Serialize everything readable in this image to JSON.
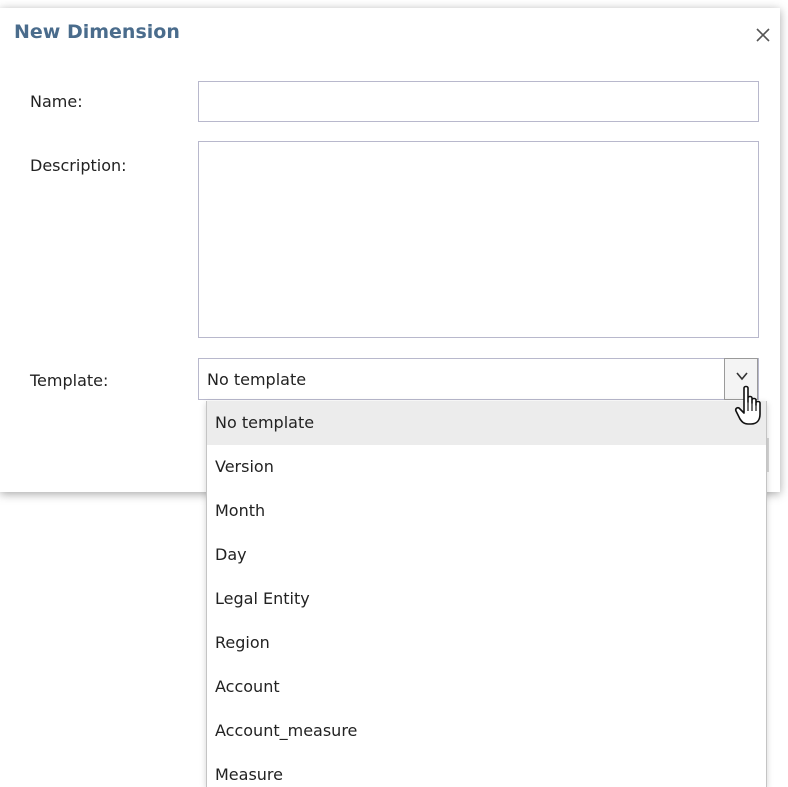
{
  "dialog": {
    "title": "New Dimension",
    "close_label": "×"
  },
  "form": {
    "name_label": "Name:",
    "name_value": "",
    "description_label": "Description:",
    "description_value": "",
    "template_label": "Template:",
    "template_value": "No template"
  },
  "dropdown": {
    "items": [
      "No template",
      "Version",
      "Month",
      "Day",
      "Legal Entity",
      "Region",
      "Account",
      "Account_measure",
      "Measure"
    ],
    "selected": "No template"
  },
  "colors": {
    "title": "#4a6c8c",
    "field_border": "#b8b8cc",
    "selected_item_bg": "#ececec"
  }
}
